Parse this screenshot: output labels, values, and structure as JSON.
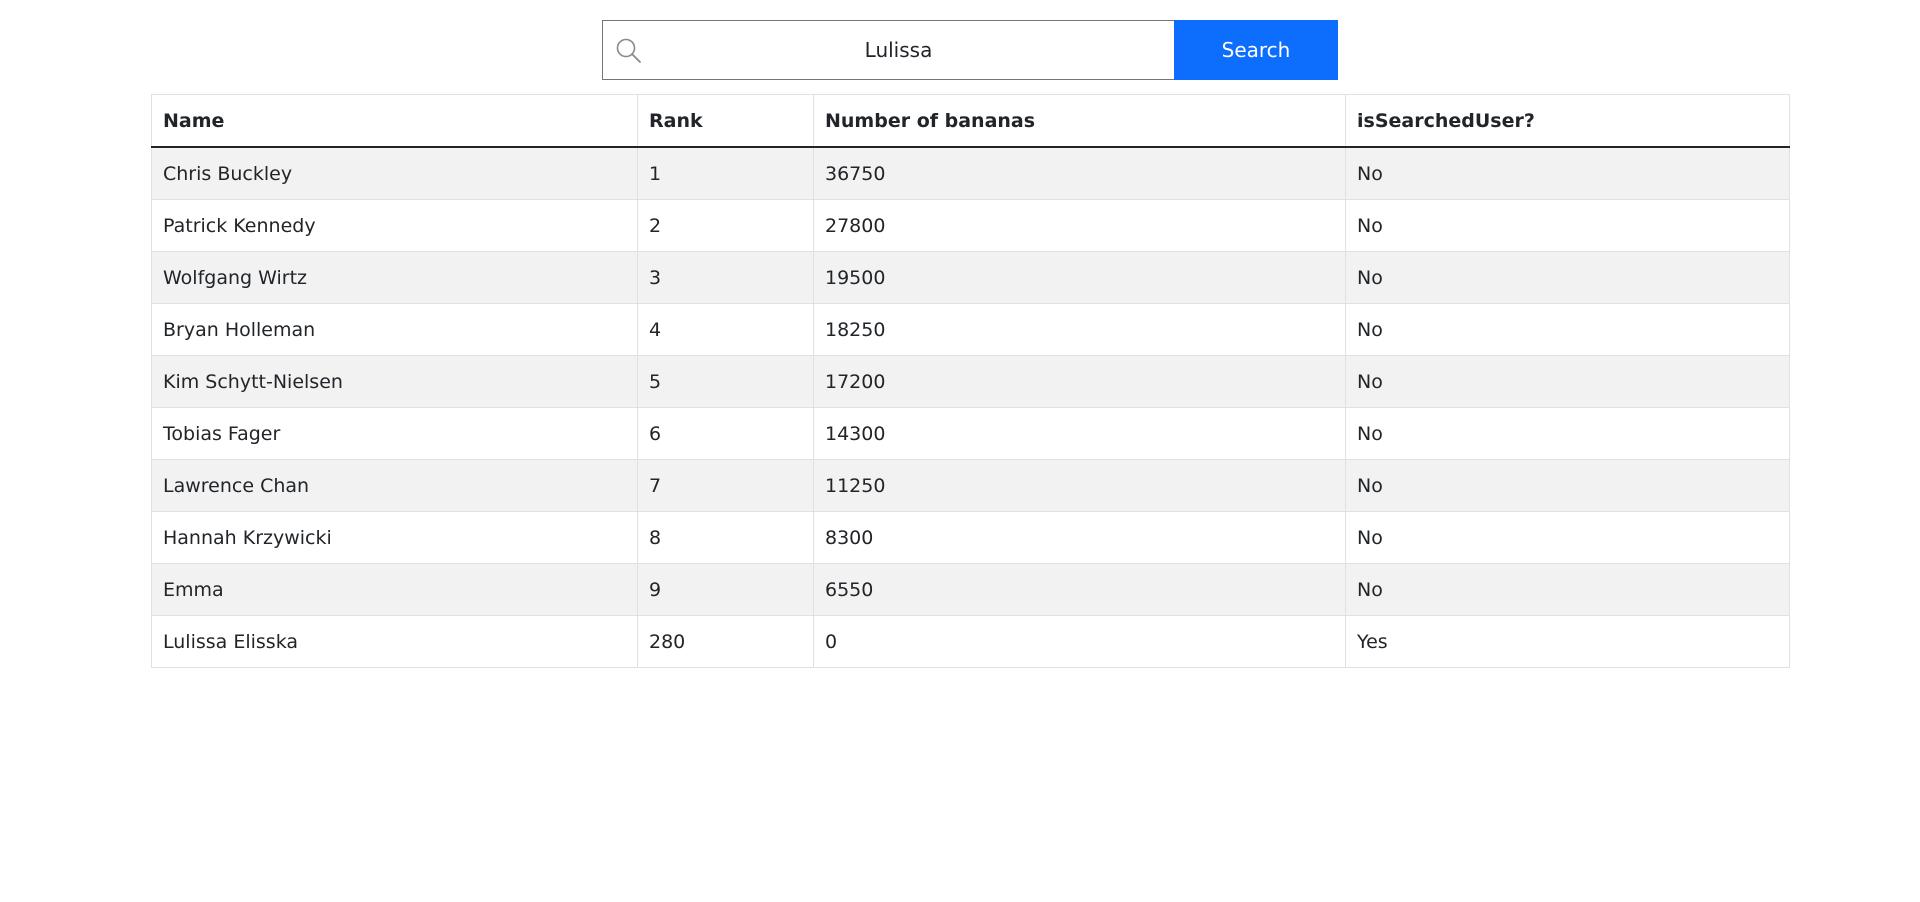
{
  "search": {
    "value": "Lulissa",
    "button_label": "Search"
  },
  "table": {
    "headers": [
      "Name",
      "Rank",
      "Number of bananas",
      "isSearchedUser?"
    ],
    "rows": [
      [
        "Chris Buckley",
        "1",
        "36750",
        "No"
      ],
      [
        "Patrick Kennedy",
        "2",
        "27800",
        "No"
      ],
      [
        "Wolfgang Wirtz",
        "3",
        "19500",
        "No"
      ],
      [
        "Bryan Holleman",
        "4",
        "18250",
        "No"
      ],
      [
        "Kim Schytt-Nielsen",
        "5",
        "17200",
        "No"
      ],
      [
        "Tobias Fager",
        "6",
        "14300",
        "No"
      ],
      [
        "Lawrence Chan",
        "7",
        "11250",
        "No"
      ],
      [
        "Hannah Krzywicki",
        "8",
        "8300",
        "No"
      ],
      [
        "Emma",
        "9",
        "6550",
        "No"
      ],
      [
        "Lulissa Elisska",
        "280",
        "0",
        "Yes"
      ]
    ]
  },
  "icons": {
    "search": "search-icon"
  },
  "colors": {
    "accent": "#0d6efd",
    "stripe": "#f2f2f2",
    "border": "#dee2e6"
  }
}
